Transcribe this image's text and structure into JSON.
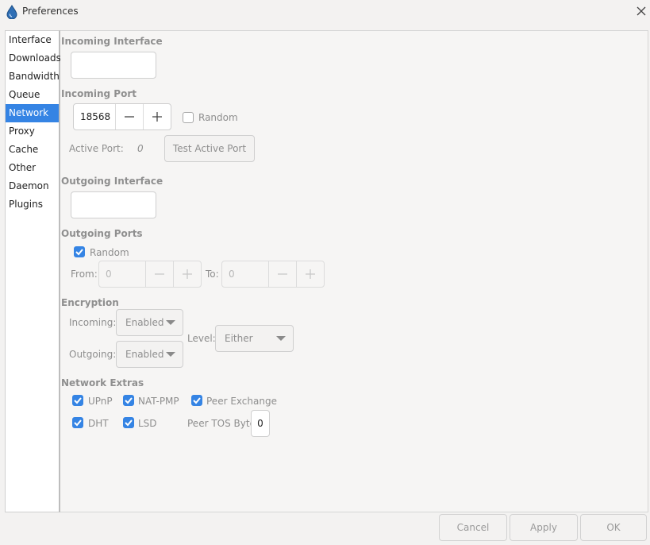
{
  "window": {
    "title": "Preferences",
    "app_icon": "water-drop-icon",
    "close_icon": "close-icon"
  },
  "sidebar": {
    "items": [
      {
        "label": "Interface"
      },
      {
        "label": "Downloads"
      },
      {
        "label": "Bandwidth"
      },
      {
        "label": "Queue"
      },
      {
        "label": "Network",
        "selected": true
      },
      {
        "label": "Proxy"
      },
      {
        "label": "Cache"
      },
      {
        "label": "Other"
      },
      {
        "label": "Daemon"
      },
      {
        "label": "Plugins"
      }
    ]
  },
  "network": {
    "incoming_interface": {
      "title": "Incoming Interface",
      "value": ""
    },
    "incoming_port": {
      "title": "Incoming Port",
      "value": "18568",
      "random_label": "Random",
      "random_checked": false,
      "active_port_label": "Active Port:",
      "active_port_value": "0",
      "test_button": "Test Active Port"
    },
    "outgoing_interface": {
      "title": "Outgoing Interface",
      "value": ""
    },
    "outgoing_ports": {
      "title": "Outgoing Ports",
      "random_label": "Random",
      "random_checked": true,
      "from_label": "From:",
      "from_value": "0",
      "to_label": "To:",
      "to_value": "0"
    },
    "encryption": {
      "title": "Encryption",
      "incoming_label": "Incoming:",
      "incoming_value": "Enabled",
      "outgoing_label": "Outgoing:",
      "outgoing_value": "Enabled",
      "level_label": "Level:",
      "level_value": "Either"
    },
    "extras": {
      "title": "Network Extras",
      "upnp": "UPnP",
      "natpmp": "NAT-PMP",
      "peer_exchange": "Peer Exchange",
      "dht": "DHT",
      "lsd": "LSD",
      "tos_label": "Peer TOS Byte:",
      "tos_value": "0"
    }
  },
  "buttons": {
    "cancel": "Cancel",
    "apply": "Apply",
    "ok": "OK"
  },
  "colors": {
    "accent": "#3584e4",
    "section_title": "#8f8f8f"
  }
}
